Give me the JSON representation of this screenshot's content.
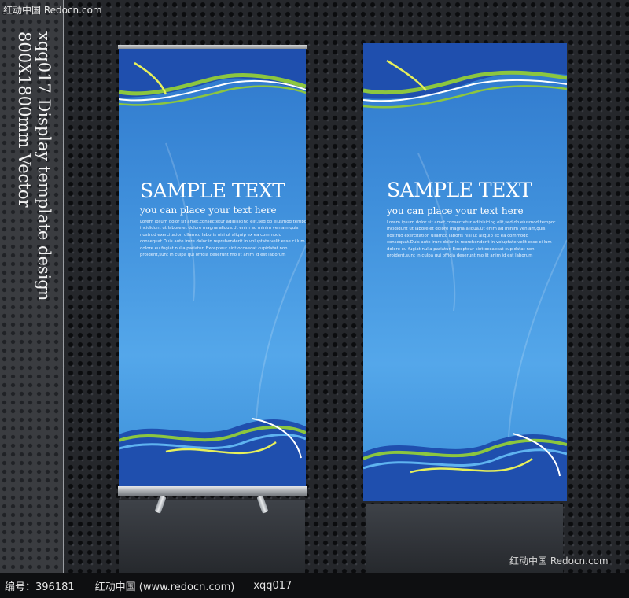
{
  "watermark": {
    "top": "红动中国  Redocn.com",
    "bottom": "红动中国  Redocn.com"
  },
  "caption": {
    "line1": "xqq017 Display template design",
    "line2": "800X1800mm Vector"
  },
  "banners": [
    {
      "title": "SAMPLE TEXT",
      "subtitle": "you can place your text here",
      "body": "Lorem ipsum dolor sit amet,consectetur adipisicing elit,sed do eiusmod tempor\nincididunt ut labore et dolore magna aliqua.Ut enim ad minim veniam,quis\nnostrud exercitation ullamco laboris nisi ut aliquip ex ea commodo\nconsequat.Duis aute irure dolor in reprehenderit in voluptate velit esse cillum\ndolore eu fugiat nulla pariatur. Excepteur sint occaecat cupidatat non\nproident,sunt in culpa qui officia deserunt mollit anim id est laborum"
    },
    {
      "title": "SAMPLE TEXT",
      "subtitle": "you can place your text here",
      "body": "Lorem ipsum dolor sit amet,consectetur adipisicing elit,sed do eiusmod tempor\nincididunt ut labore et dolore magna aliqua.Ut enim ad minim veniam,quis\nnostrud exercitation ullamco laboris nisi ut aliquip ex ea commodo\nconsequat.Duis aute irure dolor in reprehenderit in voluptate velit esse cillum\ndolore eu fugiat nulla pariatur. Excepteur sint occaecat cupidatat non\nproident,sunt in culpa qui officia deserunt mollit anim id est laborum"
    }
  ],
  "footer": {
    "id_text": "编号：396181",
    "site_text": "红动中国 (www.redocn.com)",
    "code_text": "xqq017"
  },
  "colors": {
    "banner_blue": "#3f8fdb",
    "wave_dark": "#1f4fae",
    "wave_green": "#8cc63f",
    "background": "#25272b"
  }
}
